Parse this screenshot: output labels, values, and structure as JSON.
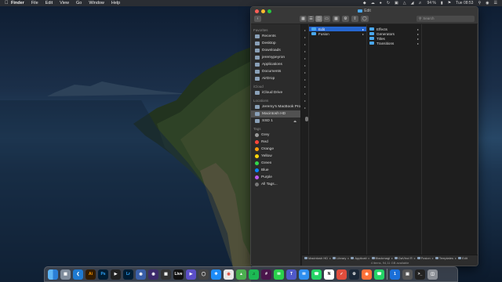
{
  "menubar": {
    "apple_icon": "apple-icon",
    "app_name": "Finder",
    "items": [
      "File",
      "Edit",
      "View",
      "Go",
      "Window",
      "Help"
    ],
    "battery": "94 %",
    "clock": "Tue 08:53"
  },
  "window": {
    "title": "Edit",
    "search_placeholder": "Search",
    "sidebar": {
      "favorites_header": "Favorites",
      "favorites": [
        "Recents",
        "Desktop",
        "Downloads",
        "jeremypeyron",
        "Applications",
        "Documents",
        "AirDrop"
      ],
      "icloud_header": "iCloud",
      "icloud": [
        "iCloud Drive"
      ],
      "locations_header": "Locations",
      "locations": [
        "Jeremy's MacBook Pro",
        "Macintosh HD",
        "SSD 1"
      ],
      "tags_header": "Tags",
      "tags": [
        {
          "label": "Grey",
          "color": "#9a9a9a"
        },
        {
          "label": "Red",
          "color": "#ff453a"
        },
        {
          "label": "Orange",
          "color": "#ff9f0a"
        },
        {
          "label": "Yellow",
          "color": "#ffd60a"
        },
        {
          "label": "Green",
          "color": "#32d74b"
        },
        {
          "label": "Blue",
          "color": "#0a84ff"
        },
        {
          "label": "Purple",
          "color": "#bf5af2"
        },
        {
          "label": "All Tags...",
          "color": "#777777"
        }
      ]
    },
    "column2": [
      "Edit",
      "Fusion"
    ],
    "column3": [
      "Effects",
      "Generators",
      "Titles",
      "Transitions"
    ],
    "path": [
      "Macintosh HD",
      "Library",
      "Applicati",
      "Blackmagi",
      "DaVinci R",
      "Fusion",
      "Templates",
      "Edit"
    ],
    "status": "4 items, 94,11 GB available"
  },
  "dock": [
    "Finder",
    "Launchpad",
    "Visual Studio Code",
    "Illustrator",
    "Photoshop",
    "Final Cut",
    "Lightroom",
    "Resolve",
    "Motion",
    "Compressor",
    "Ableton Live",
    "Player",
    "Sync",
    "Safari",
    "Chrome",
    "Maps",
    "Spotify",
    "Slack",
    "Messages",
    "Teams",
    "Mail",
    "WhatsApp",
    "Notion",
    "Tasks",
    "Steam",
    "Firefox",
    "WhatsApp",
    "1Password",
    "Preview",
    "Terminal",
    "Trash"
  ]
}
